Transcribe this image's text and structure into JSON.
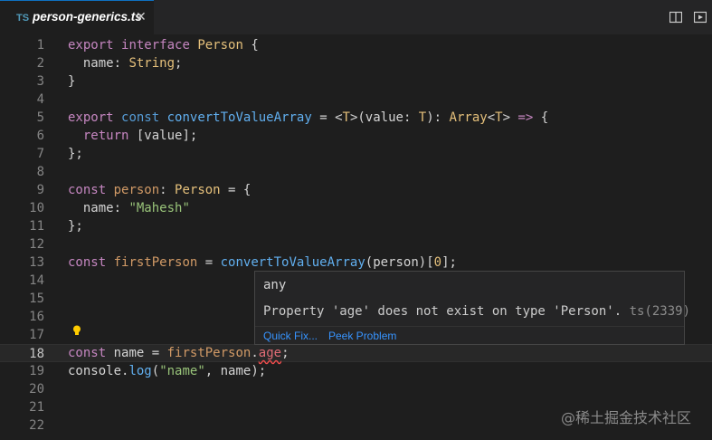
{
  "tab": {
    "lang_badge": "TS",
    "filename": "person-generics.ts",
    "close_glyph": "✕"
  },
  "toolbar": {
    "icons": [
      "split-editor-icon",
      "open-preview-icon"
    ]
  },
  "lines": [
    {
      "n": "1"
    },
    {
      "n": "2"
    },
    {
      "n": "3"
    },
    {
      "n": "4"
    },
    {
      "n": "5"
    },
    {
      "n": "6"
    },
    {
      "n": "7"
    },
    {
      "n": "8"
    },
    {
      "n": "9"
    },
    {
      "n": "10"
    },
    {
      "n": "11"
    },
    {
      "n": "12"
    },
    {
      "n": "13"
    },
    {
      "n": "14"
    },
    {
      "n": "15"
    },
    {
      "n": "16"
    },
    {
      "n": "17"
    },
    {
      "n": "18"
    },
    {
      "n": "19"
    },
    {
      "n": "20"
    },
    {
      "n": "21"
    },
    {
      "n": "22"
    }
  ],
  "code": {
    "l1": [
      "export",
      " ",
      "interface",
      " ",
      "Person",
      " {"
    ],
    "l2": [
      "  name",
      ": ",
      "String",
      ";"
    ],
    "l3": "}",
    "l5": [
      "export",
      " ",
      "const",
      " ",
      "convertToValueArray",
      " = ",
      "<",
      "T",
      ">(value: ",
      "T",
      "): ",
      "Array",
      "<",
      "T",
      "> ",
      "=>",
      " {"
    ],
    "l6": [
      "  ",
      "return",
      " [value];"
    ],
    "l7": "};",
    "l9": [
      "const",
      " ",
      "person",
      ": ",
      "Person",
      " = {"
    ],
    "l10": [
      "  name",
      ": ",
      "\"Mahesh\""
    ],
    "l11": "};",
    "l13": [
      "const",
      " ",
      "firstPerson",
      " = ",
      "convertToValueArray",
      "(person)[",
      "0",
      "];"
    ],
    "l18": [
      "const",
      " ",
      "name",
      " = ",
      "firstPerson",
      ".",
      "age",
      ";"
    ],
    "l19": [
      "console",
      ".",
      "log",
      "(",
      "\"name\"",
      ", name);"
    ]
  },
  "hover": {
    "type": "any",
    "message": "Property 'age' does not exist on type 'Person'. ",
    "error_code": "ts(2339)",
    "quick_fix": "Quick Fix...",
    "peek_problem": "Peek Problem"
  },
  "watermark": "@稀土掘金技术社区",
  "colors": {
    "keyword": "#c586c0",
    "type": "#e5c07b",
    "function": "#61afef",
    "string": "#98c379",
    "error": "#f14c4c"
  }
}
